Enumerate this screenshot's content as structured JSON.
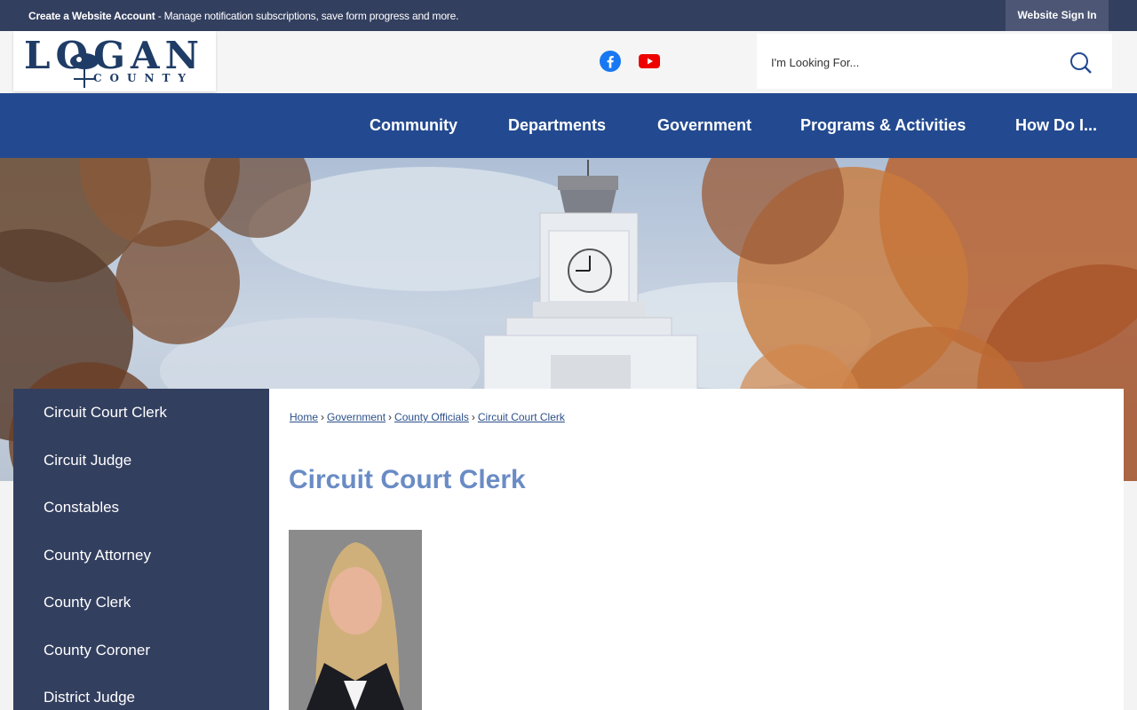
{
  "topbar": {
    "account_link": "Create a Website Account",
    "account_desc": " - Manage notification subscriptions, save form progress and more.",
    "signin": "Website Sign In"
  },
  "logo": {
    "name": "LOGAN",
    "sub": "COUNTY"
  },
  "social": {
    "facebook": "facebook-icon",
    "youtube": "youtube-icon"
  },
  "search": {
    "placeholder": "I'm Looking For...",
    "icon": "search-icon"
  },
  "nav": [
    "Community",
    "Departments",
    "Government",
    "Programs & Activities",
    "How Do I..."
  ],
  "sidebar": [
    "Circuit Court Clerk",
    "Circuit Judge",
    "Constables",
    "County Attorney",
    "County Clerk",
    "County Coroner",
    "District Judge"
  ],
  "breadcrumb": [
    "Home",
    "Government",
    "County Officials",
    "Circuit Court Clerk"
  ],
  "page_title": "Circuit Court Clerk",
  "colors": {
    "topbar": "#333f5f",
    "nav": "#234a90",
    "sidebar": "#333f5f",
    "title": "#6a8cc5"
  }
}
